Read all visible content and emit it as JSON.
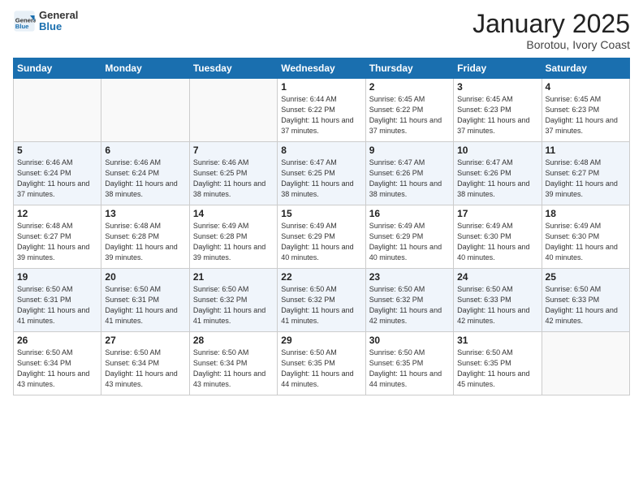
{
  "header": {
    "logo_general": "General",
    "logo_blue": "Blue",
    "month_title": "January 2025",
    "location": "Borotou, Ivory Coast"
  },
  "weekdays": [
    "Sunday",
    "Monday",
    "Tuesday",
    "Wednesday",
    "Thursday",
    "Friday",
    "Saturday"
  ],
  "weeks": [
    [
      {
        "day": "",
        "info": ""
      },
      {
        "day": "",
        "info": ""
      },
      {
        "day": "",
        "info": ""
      },
      {
        "day": "1",
        "info": "Sunrise: 6:44 AM\nSunset: 6:22 PM\nDaylight: 11 hours\nand 37 minutes."
      },
      {
        "day": "2",
        "info": "Sunrise: 6:45 AM\nSunset: 6:22 PM\nDaylight: 11 hours\nand 37 minutes."
      },
      {
        "day": "3",
        "info": "Sunrise: 6:45 AM\nSunset: 6:23 PM\nDaylight: 11 hours\nand 37 minutes."
      },
      {
        "day": "4",
        "info": "Sunrise: 6:45 AM\nSunset: 6:23 PM\nDaylight: 11 hours\nand 37 minutes."
      }
    ],
    [
      {
        "day": "5",
        "info": "Sunrise: 6:46 AM\nSunset: 6:24 PM\nDaylight: 11 hours\nand 37 minutes."
      },
      {
        "day": "6",
        "info": "Sunrise: 6:46 AM\nSunset: 6:24 PM\nDaylight: 11 hours\nand 38 minutes."
      },
      {
        "day": "7",
        "info": "Sunrise: 6:46 AM\nSunset: 6:25 PM\nDaylight: 11 hours\nand 38 minutes."
      },
      {
        "day": "8",
        "info": "Sunrise: 6:47 AM\nSunset: 6:25 PM\nDaylight: 11 hours\nand 38 minutes."
      },
      {
        "day": "9",
        "info": "Sunrise: 6:47 AM\nSunset: 6:26 PM\nDaylight: 11 hours\nand 38 minutes."
      },
      {
        "day": "10",
        "info": "Sunrise: 6:47 AM\nSunset: 6:26 PM\nDaylight: 11 hours\nand 38 minutes."
      },
      {
        "day": "11",
        "info": "Sunrise: 6:48 AM\nSunset: 6:27 PM\nDaylight: 11 hours\nand 39 minutes."
      }
    ],
    [
      {
        "day": "12",
        "info": "Sunrise: 6:48 AM\nSunset: 6:27 PM\nDaylight: 11 hours\nand 39 minutes."
      },
      {
        "day": "13",
        "info": "Sunrise: 6:48 AM\nSunset: 6:28 PM\nDaylight: 11 hours\nand 39 minutes."
      },
      {
        "day": "14",
        "info": "Sunrise: 6:49 AM\nSunset: 6:28 PM\nDaylight: 11 hours\nand 39 minutes."
      },
      {
        "day": "15",
        "info": "Sunrise: 6:49 AM\nSunset: 6:29 PM\nDaylight: 11 hours\nand 40 minutes."
      },
      {
        "day": "16",
        "info": "Sunrise: 6:49 AM\nSunset: 6:29 PM\nDaylight: 11 hours\nand 40 minutes."
      },
      {
        "day": "17",
        "info": "Sunrise: 6:49 AM\nSunset: 6:30 PM\nDaylight: 11 hours\nand 40 minutes."
      },
      {
        "day": "18",
        "info": "Sunrise: 6:49 AM\nSunset: 6:30 PM\nDaylight: 11 hours\nand 40 minutes."
      }
    ],
    [
      {
        "day": "19",
        "info": "Sunrise: 6:50 AM\nSunset: 6:31 PM\nDaylight: 11 hours\nand 41 minutes."
      },
      {
        "day": "20",
        "info": "Sunrise: 6:50 AM\nSunset: 6:31 PM\nDaylight: 11 hours\nand 41 minutes."
      },
      {
        "day": "21",
        "info": "Sunrise: 6:50 AM\nSunset: 6:32 PM\nDaylight: 11 hours\nand 41 minutes."
      },
      {
        "day": "22",
        "info": "Sunrise: 6:50 AM\nSunset: 6:32 PM\nDaylight: 11 hours\nand 41 minutes."
      },
      {
        "day": "23",
        "info": "Sunrise: 6:50 AM\nSunset: 6:32 PM\nDaylight: 11 hours\nand 42 minutes."
      },
      {
        "day": "24",
        "info": "Sunrise: 6:50 AM\nSunset: 6:33 PM\nDaylight: 11 hours\nand 42 minutes."
      },
      {
        "day": "25",
        "info": "Sunrise: 6:50 AM\nSunset: 6:33 PM\nDaylight: 11 hours\nand 42 minutes."
      }
    ],
    [
      {
        "day": "26",
        "info": "Sunrise: 6:50 AM\nSunset: 6:34 PM\nDaylight: 11 hours\nand 43 minutes."
      },
      {
        "day": "27",
        "info": "Sunrise: 6:50 AM\nSunset: 6:34 PM\nDaylight: 11 hours\nand 43 minutes."
      },
      {
        "day": "28",
        "info": "Sunrise: 6:50 AM\nSunset: 6:34 PM\nDaylight: 11 hours\nand 43 minutes."
      },
      {
        "day": "29",
        "info": "Sunrise: 6:50 AM\nSunset: 6:35 PM\nDaylight: 11 hours\nand 44 minutes."
      },
      {
        "day": "30",
        "info": "Sunrise: 6:50 AM\nSunset: 6:35 PM\nDaylight: 11 hours\nand 44 minutes."
      },
      {
        "day": "31",
        "info": "Sunrise: 6:50 AM\nSunset: 6:35 PM\nDaylight: 11 hours\nand 45 minutes."
      },
      {
        "day": "",
        "info": ""
      }
    ]
  ]
}
